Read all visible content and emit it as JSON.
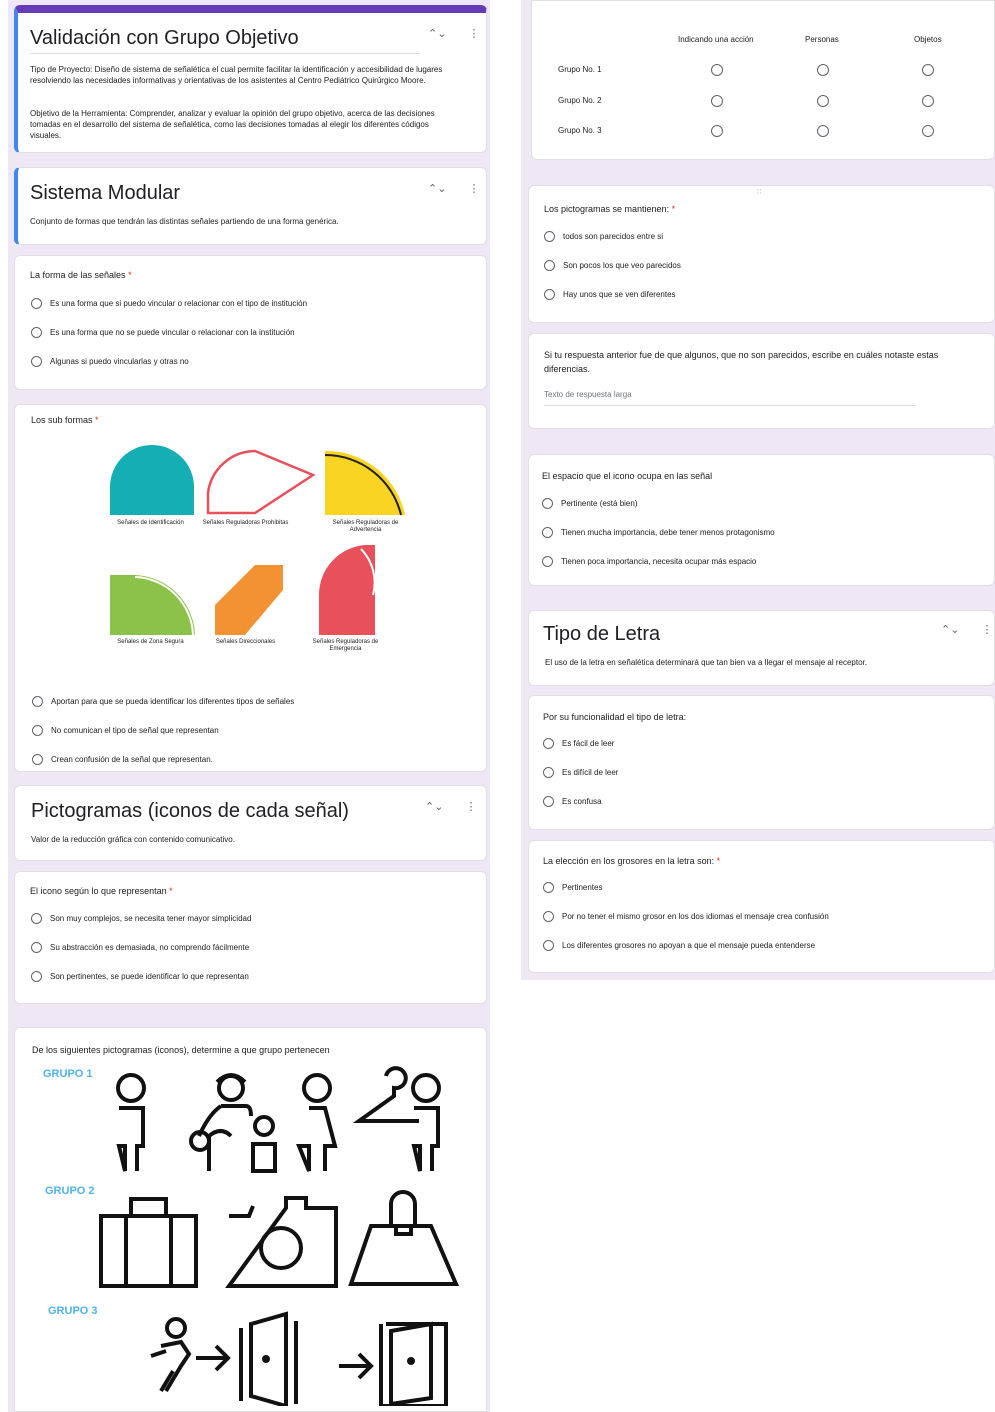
{
  "left": {
    "card1": {
      "title": "Validación con Grupo Objetivo",
      "desc1": "Tipo de Proyecto: Diseño de sistema de señalética el cual permite facilitar la identificación y accesibilidad de lugares resolviendo las necesidades informativas y orientativas de los asistentes al Centro Pediátrico Quirúrgico Moore.",
      "desc2": "Objetivo de la Herramienta: Comprender, analizar y evaluar la opinión del grupo objetivo, acerca de las decisiones tomadas en el desarrollo del sistema de señalética, como las decisiones tomadas al elegir los diferentes códigos visuales."
    },
    "section2": {
      "title": "Sistema Modular",
      "desc": "Conjunto de formas que tendrán las distintas señales partiendo de una forma genérica."
    },
    "q_forma": {
      "label": "La forma de las señales",
      "required": "*",
      "options": [
        "Es una forma que si puedo vincular o relacionar con el tipo de institución",
        "Es una forma que no se puede vincular o relacionar con la institución",
        "Algunas si puedo vincularlas y otras no"
      ]
    },
    "q_sub": {
      "label": "Los sub formas",
      "required": "*",
      "captions": [
        "Señales de Identificación",
        "Señales Reguladoras Prohibitas",
        "Señales Reguladoras de Advertencia",
        "Señales de Zona Segura",
        "Señales Direccionales",
        "Señales Reguladoras de Emergencia"
      ],
      "options": [
        "Aportan para que se pueda identificar los diferentes tipos de señales",
        "No comunican el tipo de señal que representan",
        "Crean confusión de la señal que representan."
      ]
    },
    "section3": {
      "title": "Pictogramas (iconos de cada señal)",
      "desc": "Valor de la reducción gráfica con contenido comunicativo."
    },
    "q_icono": {
      "label": "El icono según lo que representan",
      "required": "*",
      "options": [
        "Son muy complejos, se necesita tener mayor simplicidad",
        "Su abstracción es demasiada, no comprendo fácilmente",
        "Son pertinentes, se puede identificar lo que representan"
      ]
    },
    "q_picto": {
      "label": "De los siguientes pictogramas (iconos), determine a que grupo pertenecen",
      "groups": [
        "GRUPO 1",
        "GRUPO 2",
        "GRUPO 3"
      ]
    }
  },
  "right": {
    "grid": {
      "columns": [
        "Indicando una acción",
        "Personas",
        "Objetos"
      ],
      "rows": [
        "Grupo No. 1",
        "Grupo No. 2",
        "Grupo No. 3"
      ]
    },
    "q_mantienen": {
      "label": "Los pictogramas se mantienen:",
      "required": "*",
      "options": [
        "todos son parecidos entre si",
        "Son pocos los que veo parecidos",
        "Hay unos que se ven diferentes"
      ]
    },
    "q_diferencias": {
      "label": "Si tu respuesta anterior fue de que algunos, que no son parecidos, escribe en cuáles notaste estas diferencias.",
      "placeholder": "Texto de respuesta larga"
    },
    "q_espacio": {
      "label": "El espacio que el icono ocupa en las señal",
      "options": [
        "Pertinente (está bien)",
        "Tienen mucha importancia, debe tener menos protagonismo",
        "Tienen poca importancia, necesita ocupar más espacio"
      ]
    },
    "section4": {
      "title": "Tipo de Letra",
      "desc": "El uso de la letra en señalética determinará que tan bien va a llegar el mensaje al receptor."
    },
    "q_funcionalidad": {
      "label": "Por su funcionalidad el tipo de letra:",
      "options": [
        "Es fácil de leer",
        "Es difícil de leer",
        "Es confusa"
      ]
    },
    "q_grosores": {
      "label": "La elección en los grosores en la letra son:",
      "required": "*",
      "options": [
        "Pertinentes",
        "Por no tener el mismo grosor en los dos idiomas el mensaje crea confusión",
        "Los diferentes grosores no apoyan a que el mensaje pueda entenderse"
      ]
    }
  },
  "colors": {
    "accent_purple": "#673ab7",
    "accent_blue": "#4285f4",
    "background": "#ede7f6",
    "group_label": "#4fb3e8",
    "shape_teal": "#14aeb4",
    "shape_red": "#e8505b",
    "shape_yellow": "#f9d423",
    "shape_green": "#8bc34a",
    "shape_orange": "#f39233"
  },
  "icons": [
    "collapse-icon",
    "more-vert-icon",
    "drag-handle-icon"
  ]
}
